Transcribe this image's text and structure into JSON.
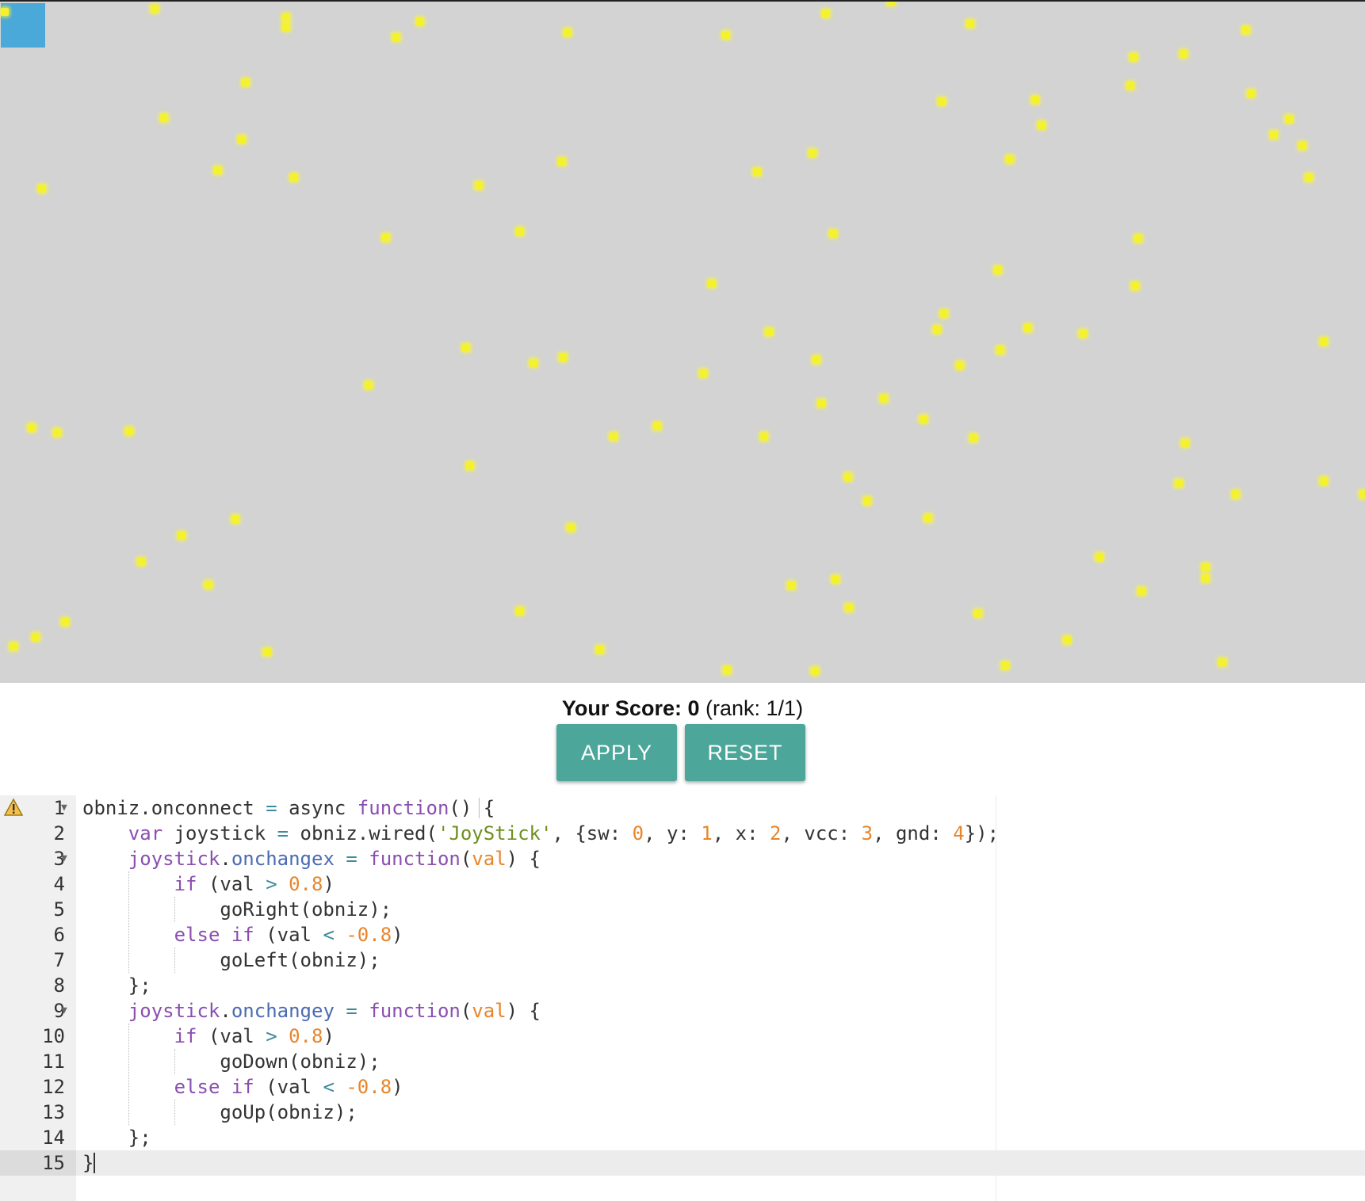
{
  "score": {
    "label": "Your Score:",
    "value": "0",
    "rank": "(rank: 1/1)"
  },
  "buttons": {
    "apply": "APPLY",
    "reset": "RESET"
  },
  "colors": {
    "board": "#d3d3d3",
    "player": "#4aa9d8",
    "dot": "#f4f22e",
    "button": "#4da69a"
  },
  "editor": {
    "line_numbers": [
      "1",
      "2",
      "3",
      "4",
      "5",
      "6",
      "7",
      "8",
      "9",
      "10",
      "11",
      "12",
      "13",
      "14",
      "15"
    ],
    "lines": [
      "obniz.onconnect = async function() {",
      "    var joystick = obniz.wired('JoyStick', {sw: 0, y: 1, x: 2, vcc: 3, gnd: 4});",
      "    joystick.onchangex = function(val) {",
      "        if (val > 0.8)",
      "            goRight(obniz);",
      "        else if (val < -0.8)",
      "            goLeft(obniz);",
      "    };",
      "    joystick.onchangey = function(val) {",
      "        if (val > 0.8)",
      "            goDown(obniz);",
      "        else if (val < -0.8)",
      "            goUp(obniz);",
      "    };",
      "}"
    ]
  }
}
